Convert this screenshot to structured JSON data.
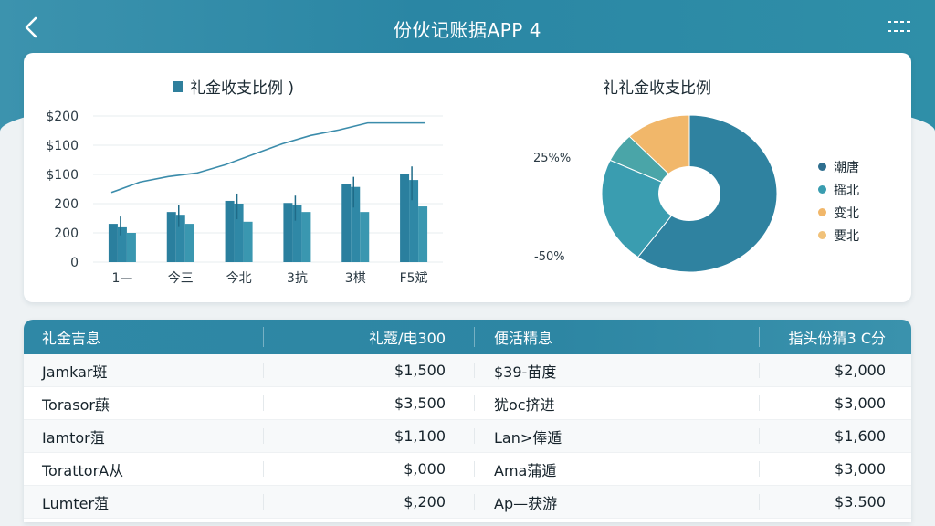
{
  "header": {
    "title": "份伙记账据APP 4",
    "back_icon": "chevron-left-icon",
    "menu_icon": "menu-icon"
  },
  "colors": {
    "accent": "#2a86a4",
    "bar_dark": "#2a7f9e",
    "bar_light": "#3a97b0",
    "pie_blue": "#2f82a0",
    "pie_teal": "#3a9db0",
    "pie_orange": "#f1b76a",
    "pie_peach": "#f1c27a"
  },
  "chart_data": [
    {
      "type": "bar",
      "title": "礼金收支比例 )",
      "categories": [
        "1—",
        "今三",
        "今北",
        "3抗",
        "3棋",
        "F5斌"
      ],
      "yticks": [
        "$200",
        "$100",
        "$100",
        "200",
        "200",
        "0"
      ],
      "series": [
        {
          "values": [
            55,
            72,
            88,
            85,
            112,
            127
          ]
        },
        {
          "values": [
            50,
            68,
            84,
            82,
            108,
            118
          ]
        },
        {
          "values": [
            42,
            55,
            58,
            72,
            72,
            80
          ]
        }
      ],
      "line": [
        100,
        115,
        123,
        128,
        140,
        155,
        170,
        182,
        190,
        200,
        200,
        200
      ],
      "ylim": [
        0,
        210
      ],
      "grid": true
    },
    {
      "type": "pie",
      "title": "礼礼金收支比例",
      "slices": [
        {
          "label": "潮唐",
          "value": 60
        },
        {
          "label": "摇北",
          "value": 22
        },
        {
          "label": "变北",
          "value": 6
        },
        {
          "label": "要北",
          "value": 12
        }
      ],
      "labels": [
        "25%%",
        "-50%"
      ],
      "legend_position": "right"
    }
  ],
  "table": {
    "headers": [
      "礼金吉息",
      "礼蔻/电300",
      "便活精息",
      "指头份猜3 C分"
    ],
    "rows": [
      [
        "Jamkar斑",
        "$1,500",
        "$39-苗度",
        "$2,000"
      ],
      [
        "Torasor蕻",
        "$3,500",
        "犹oc挤进",
        "$3,000"
      ],
      [
        "Iamtor菹",
        "$1,100",
        "Lan>俸遁",
        "$1,600"
      ],
      [
        "TorattorA从",
        "$,000",
        "Ama蒲遁",
        "$3,000"
      ],
      [
        "Lumter菹",
        "$,200",
        "Ap—获游",
        "$3.500"
      ]
    ]
  }
}
